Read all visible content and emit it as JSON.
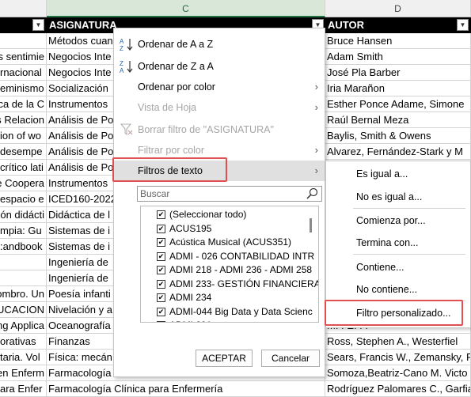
{
  "columns": {
    "c": "C",
    "d": "D"
  },
  "header_row": {
    "b": "ASIGNATURA",
    "d": "AUTOR",
    "filter_glyph": "▼"
  },
  "rows": [
    {
      "a": "",
      "b": "Métodos cuan",
      "d": "Bruce Hansen"
    },
    {
      "a": "s sentimie",
      "b": "Negocios Inte",
      "d": "Adam Smith"
    },
    {
      "a": "rnacional",
      "b": "Negocios Inte",
      "d": "José Pla Barber"
    },
    {
      "a": "eminismo",
      "b": "Socialización",
      "d": "Iria Marañon"
    },
    {
      "a": "ca de la C",
      "b": "Instrumentos",
      "d": "Esther Ponce Adame, Simone"
    },
    {
      "a": "s Relacion",
      "b": "Análisis de Po",
      "d": "Raúl Bernal Meza"
    },
    {
      "a": "ion of wo",
      "b": "Análisis de Po",
      "d": "Baylis, Smith & Owens"
    },
    {
      "a": "desempe",
      "b": "Análisis de Po",
      "d": "Alvarez, Fernández-Stark y M"
    },
    {
      "a": "crítico lati",
      "b": "Análisis de Po",
      "d": ""
    },
    {
      "a": "e Coopera",
      "b": "Instrumentos",
      "d": ""
    },
    {
      "a": "espacio e",
      "b": "ICED160-2022",
      "d": ""
    },
    {
      "a": "ión didácti",
      "b": "Didáctica de l",
      "d": ""
    },
    {
      "a": "mpia: Gu",
      "b": "Sistemas de i",
      "d": ""
    },
    {
      "a": "andbook:",
      "b": "Sistemas de i",
      "d": ""
    },
    {
      "a": "",
      "b": "Ingeniería de",
      "d": ""
    },
    {
      "a": "",
      "b": "Ingeniería de",
      "d": ""
    },
    {
      "a": "ombro. Un",
      "b": "Poesía infanti",
      "d": ""
    },
    {
      "a": "UCACION",
      "b": "Nivelación y a",
      "d": ""
    },
    {
      "a": "ng Applica",
      "b": "Oceanografía",
      "d": "M. . E.  .  ."
    },
    {
      "a": "orativas",
      "b": "Finanzas",
      "d": "Ross, Stephen A., Westerfiel"
    },
    {
      "a": "taria. Vol",
      "b": "Física: mecán",
      "d": "Sears, Francis W., Zemansky, F"
    },
    {
      "a": "en Enferm",
      "b": "Farmacología",
      "d": "Somoza,Beatriz-Cano M. Victo"
    },
    {
      "a": "ara Enfer",
      "b": "Farmacología Clínica para Enfermería",
      "d": "Rodríguez Palomares C., Garfia"
    }
  ],
  "menu": {
    "sort_az": "Ordenar de A a Z",
    "sort_za": "Ordenar de Z a A",
    "sort_color": "Ordenar por color",
    "sheet_view": "Vista de Hoja",
    "clear_filter": "Borrar filtro de \"ASIGNATURA\"",
    "filter_color": "Filtrar por color",
    "text_filters": "Filtros de texto",
    "search_placeholder": "Buscar",
    "list": [
      "(Seleccionar todo)",
      "ACUS195",
      "Acústica Musical (ACUS351)",
      "ADMI - 026 CONTABILIDAD INTR",
      "ADMI 218 - ADMI 236 - ADMI 258",
      "ADMI 233- GESTIÓN FINANCIERA",
      "ADMI 234",
      "ADMI-044 Big Data y Data Scienc",
      "ADMI 291"
    ],
    "ok": "ACEPTAR",
    "cancel": "Cancelar",
    "check_glyph": "✔",
    "arrow_glyph": "›"
  },
  "submenu": {
    "equals": "Es igual a...",
    "not_equals": "No es igual a...",
    "begins": "Comienza por...",
    "ends": "Termina con...",
    "contains": "Contiene...",
    "not_contains": "No contiene...",
    "custom": "Filtro personalizado..."
  },
  "colors": {
    "highlight_border": "#e05050",
    "header_bg": "#000000",
    "selected_col": "#217346"
  }
}
